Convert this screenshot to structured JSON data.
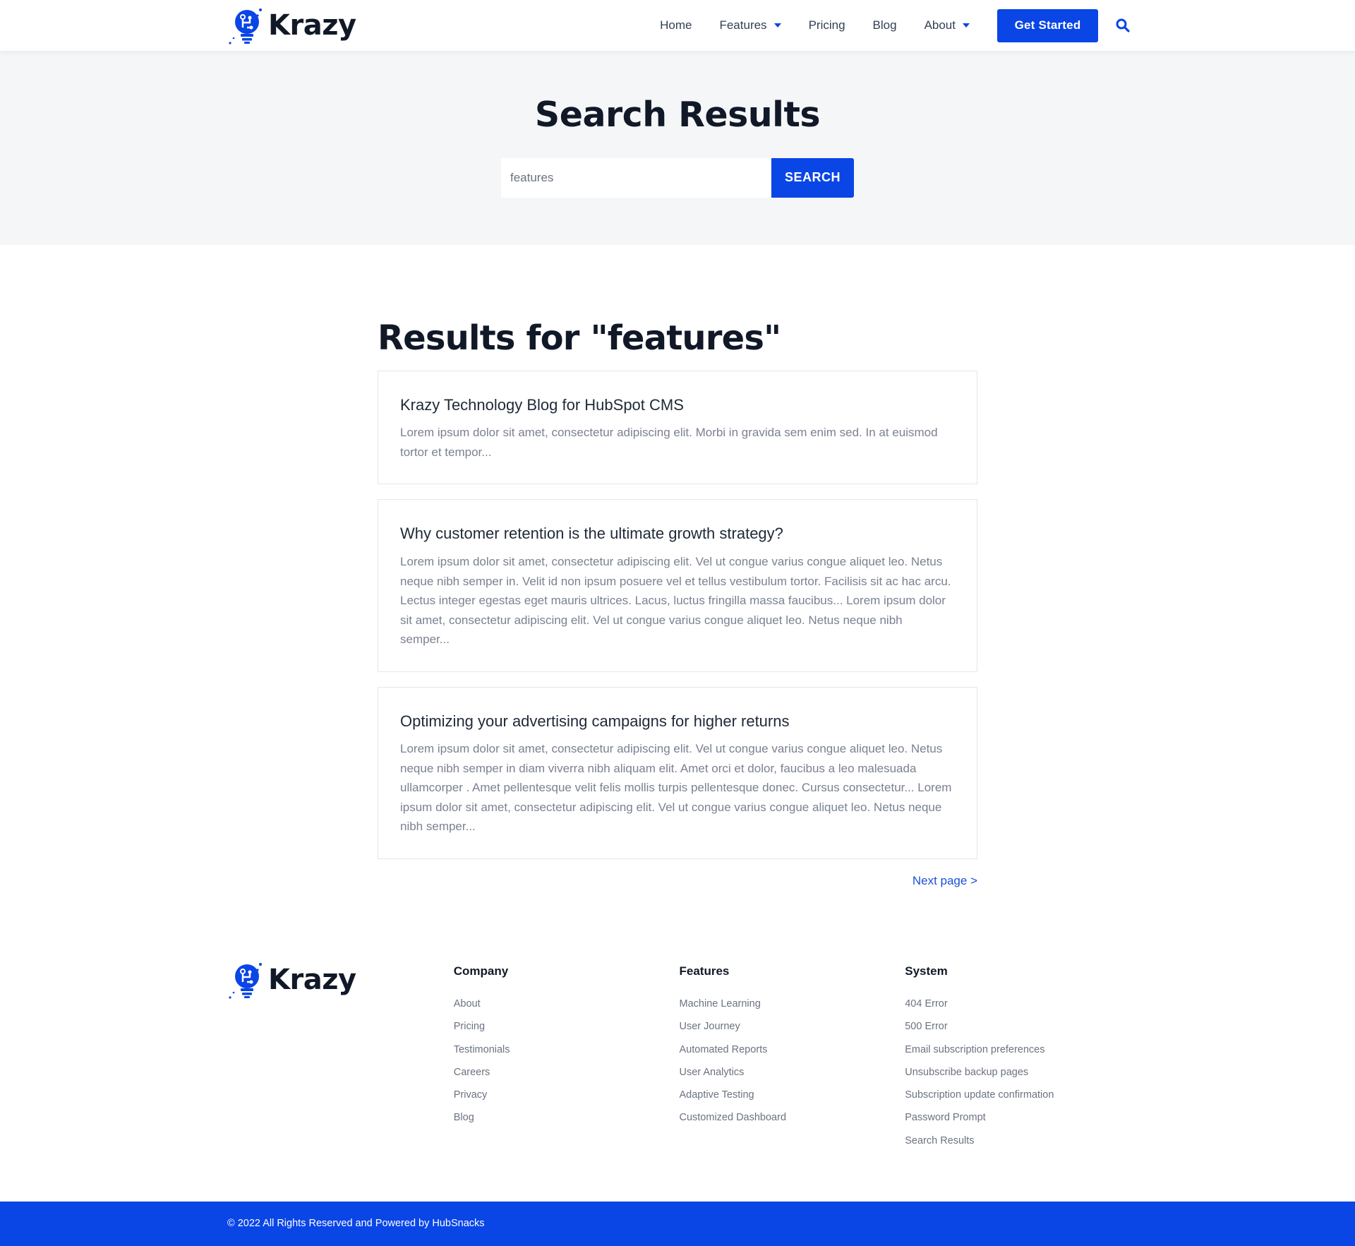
{
  "brand": {
    "name": "Krazy",
    "accent_color": "#0a45e6",
    "logo_icon": "lightbulb-circuit-icon"
  },
  "nav": {
    "items": [
      {
        "label": "Home",
        "has_dropdown": false
      },
      {
        "label": "Features",
        "has_dropdown": true
      },
      {
        "label": "Pricing",
        "has_dropdown": false
      },
      {
        "label": "Blog",
        "has_dropdown": false
      },
      {
        "label": "About",
        "has_dropdown": true
      }
    ],
    "cta_label": "Get Started",
    "search_icon": "search-icon"
  },
  "hero": {
    "title": "Search Results",
    "search_value": "features",
    "search_button": "SEARCH"
  },
  "results": {
    "heading": "Results for \"features\"",
    "items": [
      {
        "title": "Krazy Technology Blog for HubSpot CMS",
        "excerpt": "Lorem ipsum dolor sit amet, consectetur adipiscing elit. Morbi in gravida sem enim sed. In at euismod tortor et tempor..."
      },
      {
        "title": "Why customer retention is the ultimate growth strategy?",
        "excerpt": "Lorem ipsum dolor sit amet, consectetur adipiscing elit. Vel ut congue varius congue aliquet leo. Netus neque nibh semper in. Velit id non ipsum posuere vel et tellus vestibulum tortor. Facilisis sit ac hac arcu. Lectus integer egestas eget mauris ultrices. Lacus, luctus fringilla massa faucibus... Lorem ipsum dolor sit amet, consectetur adipiscing elit. Vel ut congue varius congue aliquet leo. Netus neque nibh semper..."
      },
      {
        "title": "Optimizing your advertising campaigns for higher returns",
        "excerpt": "Lorem ipsum dolor sit amet, consectetur adipiscing elit. Vel ut congue varius congue aliquet leo. Netus neque nibh semper in diam viverra nibh aliquam elit. Amet orci et dolor, faucibus a leo malesuada ullamcorper . Amet pellentesque velit felis mollis turpis pellentesque donec. Cursus consectetur... Lorem ipsum dolor sit amet, consectetur adipiscing elit. Vel ut congue varius congue aliquet leo. Netus neque nibh semper..."
      }
    ],
    "next_page": "Next page >"
  },
  "footer": {
    "columns": [
      {
        "title": "Company",
        "links": [
          "About",
          "Pricing",
          "Testimonials",
          "Careers",
          "Privacy",
          "Blog"
        ]
      },
      {
        "title": "Features",
        "links": [
          "Machine Learning",
          "User Journey",
          "Automated Reports",
          "User Analytics",
          "Adaptive Testing",
          "Customized Dashboard"
        ]
      },
      {
        "title": "System",
        "links": [
          "404 Error",
          "500 Error",
          "Email subscription preferences",
          "Unsubscribe backup pages",
          "Subscription update confirmation",
          "Password Prompt",
          "Search Results"
        ]
      }
    ],
    "copyright": "© 2022 All Rights Reserved and Powered by HubSnacks"
  }
}
